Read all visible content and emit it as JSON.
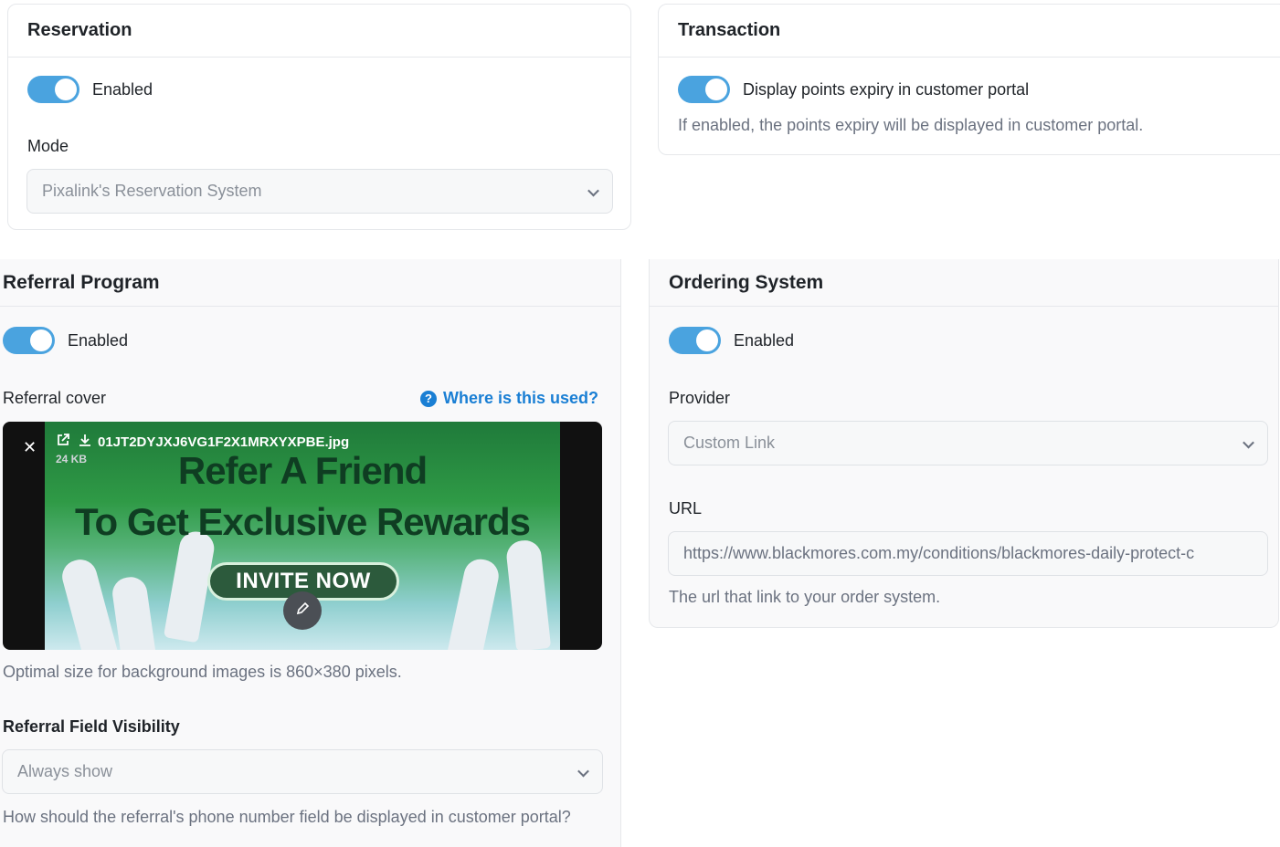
{
  "reservation": {
    "title": "Reservation",
    "toggle_label": "Enabled",
    "mode_label": "Mode",
    "mode_value": "Pixalink's Reservation System"
  },
  "transaction": {
    "title": "Transaction",
    "toggle_label": "Display points expiry in customer portal",
    "help": "If enabled, the points expiry will be displayed in customer portal."
  },
  "referral": {
    "title": "Referral Program",
    "toggle_label": "Enabled",
    "cover_label": "Referral cover",
    "where_link": "Where is this used?",
    "file_name": "01JT2DYJXJ6VG1F2X1MRXYXPBE.jpg",
    "file_size": "24 KB",
    "cover_headline_1": "Refer A Friend",
    "cover_headline_2": "To Get Exclusive Rewards",
    "cover_button": "INVITE NOW",
    "cover_help": "Optimal size for background images is 860×380 pixels.",
    "visibility_label": "Referral Field Visibility",
    "visibility_value": "Always show",
    "visibility_help": "How should the referral's phone number field be displayed in customer portal?"
  },
  "ordering": {
    "title": "Ordering System",
    "toggle_label": "Enabled",
    "provider_label": "Provider",
    "provider_value": "Custom Link",
    "url_label": "URL",
    "url_value": "https://www.blackmores.com.my/conditions/blackmores-daily-protect-c",
    "url_help": "The url that link to your order system."
  },
  "colors": {
    "toggle_on": "#4aa3df",
    "link": "#1a7fd4"
  }
}
